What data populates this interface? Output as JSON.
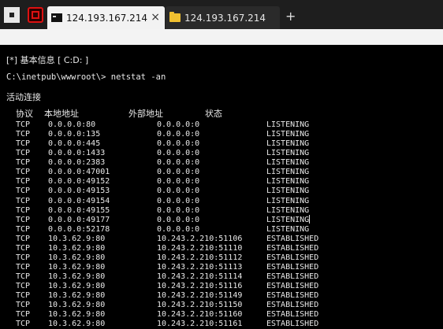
{
  "tabs": [
    {
      "label": "124.193.167.214",
      "icon": "terminal-icon",
      "active": true,
      "close": "×"
    },
    {
      "label": "124.193.167.214",
      "icon": "folder-icon",
      "active": false
    }
  ],
  "new_tab_label": "+",
  "terminal": {
    "info_line": "[*] 基本信息 [ C:D: ]",
    "command_line": "C:\\inetpub\\wwwroot\\> netstat -an",
    "section_title": "活动连接",
    "headers": {
      "proto": "协议",
      "local": "本地地址",
      "foreign": "外部地址",
      "state": "状态"
    },
    "rows": [
      {
        "proto": "TCP",
        "local": "0.0.0.0:80",
        "foreign": "0.0.0.0:0",
        "state": "LISTENING"
      },
      {
        "proto": "TCP",
        "local": "0.0.0.0:135",
        "foreign": "0.0.0.0:0",
        "state": "LISTENING"
      },
      {
        "proto": "TCP",
        "local": "0.0.0.0:445",
        "foreign": "0.0.0.0:0",
        "state": "LISTENING"
      },
      {
        "proto": "TCP",
        "local": "0.0.0.0:1433",
        "foreign": "0.0.0.0:0",
        "state": "LISTENING"
      },
      {
        "proto": "TCP",
        "local": "0.0.0.0:2383",
        "foreign": "0.0.0.0:0",
        "state": "LISTENING"
      },
      {
        "proto": "TCP",
        "local": "0.0.0.0:47001",
        "foreign": "0.0.0.0:0",
        "state": "LISTENING"
      },
      {
        "proto": "TCP",
        "local": "0.0.0.0:49152",
        "foreign": "0.0.0.0:0",
        "state": "LISTENING"
      },
      {
        "proto": "TCP",
        "local": "0.0.0.0:49153",
        "foreign": "0.0.0.0:0",
        "state": "LISTENING"
      },
      {
        "proto": "TCP",
        "local": "0.0.0.0:49154",
        "foreign": "0.0.0.0:0",
        "state": "LISTENING"
      },
      {
        "proto": "TCP",
        "local": "0.0.0.0:49155",
        "foreign": "0.0.0.0:0",
        "state": "LISTENING"
      },
      {
        "proto": "TCP",
        "local": "0.0.0.0:49177",
        "foreign": "0.0.0.0:0",
        "state": "LISTENING"
      },
      {
        "proto": "TCP",
        "local": "0.0.0.0:52178",
        "foreign": "0.0.0.0:0",
        "state": "LISTENING"
      },
      {
        "proto": "TCP",
        "local": "10.3.62.9:80",
        "foreign": "10.243.2.210:51106",
        "state": "ESTABLISHED"
      },
      {
        "proto": "TCP",
        "local": "10.3.62.9:80",
        "foreign": "10.243.2.210:51110",
        "state": "ESTABLISHED"
      },
      {
        "proto": "TCP",
        "local": "10.3.62.9:80",
        "foreign": "10.243.2.210:51112",
        "state": "ESTABLISHED"
      },
      {
        "proto": "TCP",
        "local": "10.3.62.9:80",
        "foreign": "10.243.2.210:51113",
        "state": "ESTABLISHED"
      },
      {
        "proto": "TCP",
        "local": "10.3.62.9:80",
        "foreign": "10.243.2.210:51114",
        "state": "ESTABLISHED"
      },
      {
        "proto": "TCP",
        "local": "10.3.62.9:80",
        "foreign": "10.243.2.210:51116",
        "state": "ESTABLISHED"
      },
      {
        "proto": "TCP",
        "local": "10.3.62.9:80",
        "foreign": "10.243.2.210:51149",
        "state": "ESTABLISHED"
      },
      {
        "proto": "TCP",
        "local": "10.3.62.9:80",
        "foreign": "10.243.2.210:51150",
        "state": "ESTABLISHED"
      },
      {
        "proto": "TCP",
        "local": "10.3.62.9:80",
        "foreign": "10.243.2.210:51160",
        "state": "ESTABLISHED"
      },
      {
        "proto": "TCP",
        "local": "10.3.62.9:80",
        "foreign": "10.243.2.210:51161",
        "state": "ESTABLISHED"
      }
    ]
  }
}
